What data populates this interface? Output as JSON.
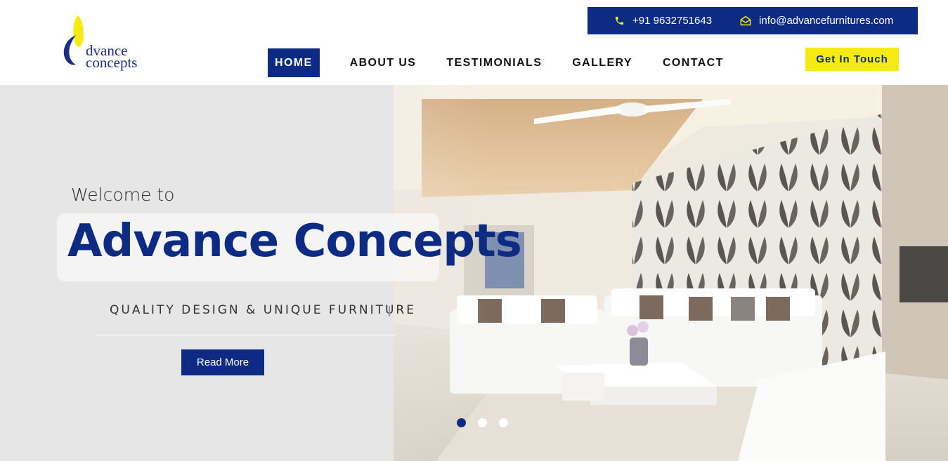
{
  "header": {
    "logo": {
      "line1": "dvance",
      "line2": "concepts",
      "accent": "#f5ea14",
      "brand": "#0d2b82"
    },
    "contact": {
      "phone": "+91 9632751643",
      "email": "info@advancefurnitures.com",
      "phone_icon": "phone-icon",
      "email_icon": "envelope-icon"
    },
    "nav": [
      {
        "label": "HOME",
        "active": true
      },
      {
        "label": "ABOUT US"
      },
      {
        "label": "TESTIMONIALS"
      },
      {
        "label": "GALLERY"
      },
      {
        "label": "CONTACT"
      }
    ],
    "cta_label": "Get In Touch"
  },
  "hero": {
    "welcome": "Welcome to",
    "title": "Advance Concepts",
    "tagline": "QUALITY DESIGN & UNIQUE FURNITURE",
    "button_label": "Read More",
    "slides": {
      "count": 3,
      "active": 1
    }
  }
}
